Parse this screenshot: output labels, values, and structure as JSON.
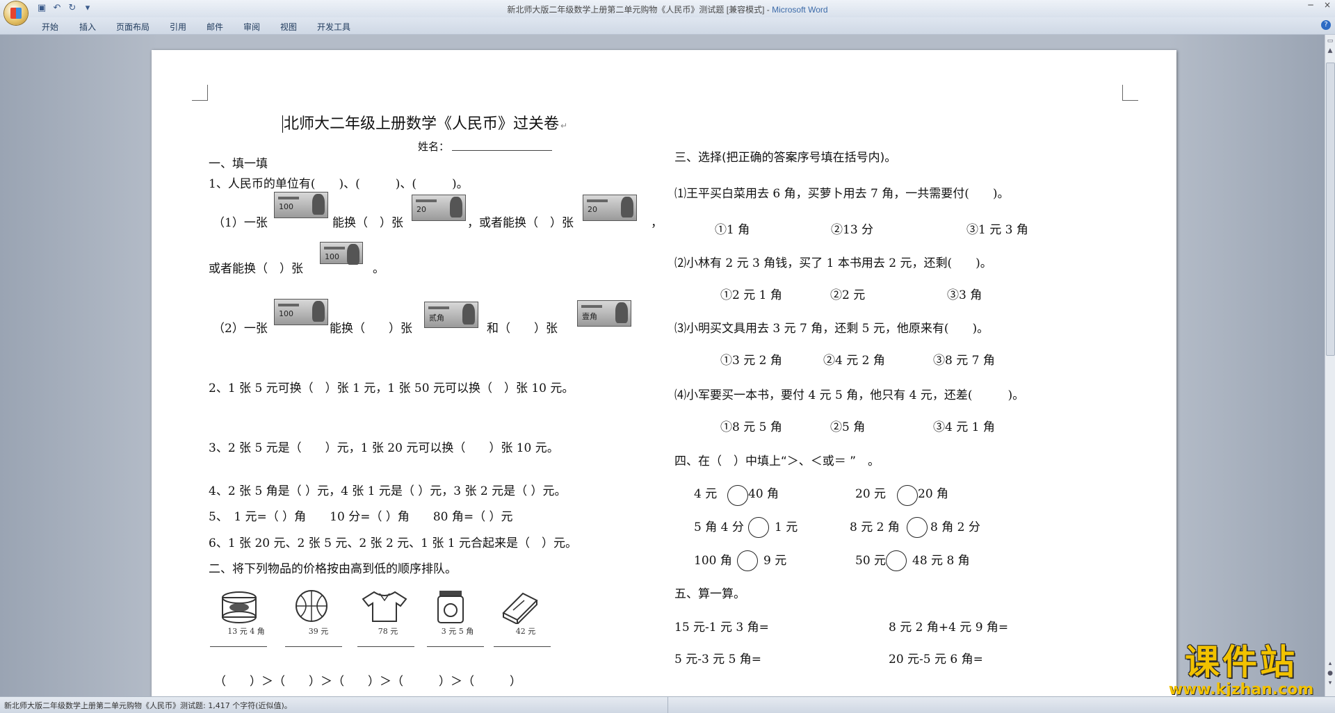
{
  "window": {
    "title": "新北师大版二年级数学上册第二单元购物《人民币》测试题 [兼容模式] - ",
    "app_name": "Microsoft Word",
    "minimize": "−",
    "close": "×"
  },
  "ribbon": {
    "tabs": [
      "开始",
      "插入",
      "页面布局",
      "引用",
      "邮件",
      "审阅",
      "视图",
      "开发工具"
    ],
    "help": "?"
  },
  "quick_access": {
    "save_icon": "save-icon",
    "undo_icon": "undo-icon",
    "redo_icon": "redo-icon",
    "customize_icon": "dropdown-icon"
  },
  "document": {
    "title": "北师大二年级上册数学《人民币》过关卷",
    "name_label": "姓名：",
    "s1_heading": "一、填一填",
    "q1": "1、人民币的单位有(　　)、(　　　)、(　　　)。",
    "q1_1a": "（1）一张",
    "q1_1b": "能换（　）张",
    "q1_1c": "，或者能换（　）张",
    "q1_1d": "，",
    "q1_1e": "或者能换（　）张",
    "q1_1f": "。",
    "q1_2a": "（2）一张",
    "q1_2b": "能换（　　）张",
    "q1_2c": "和（　　）张",
    "q2": "2、1 张 5 元可换（　）张 1 元，1 张 50 元可以换（　）张 10 元。",
    "q3": "3、2 张 5 元是（　　）元，1 张 20 元可以换（　　）张 10 元。",
    "q4": "4、2 张 5 角是（ ）元，4 张 1 元是（ ）元，3 张 2 元是（ ）元。",
    "q5": "5、　1 元=（ ）角　　10 分=（ ）角　　80 角=（ ）元",
    "q6": "6、1 张 20 元、2 张 5 元、2 张 2 元、1 张 1 元合起来是（　）元。",
    "s2_heading": "二、将下列物品的价格按由高到低的顺序排队。",
    "items": [
      {
        "icon": "can-icon",
        "price": "13 元 4 角"
      },
      {
        "icon": "basketball-icon",
        "price": "39 元"
      },
      {
        "icon": "shirt-icon",
        "price": "78 元"
      },
      {
        "icon": "jar-icon",
        "price": "3 元 5 角"
      },
      {
        "icon": "book-icon",
        "price": "42 元"
      }
    ],
    "order_row": "（　　）＞（　　）＞（　　）＞（　　　）＞（　　　）",
    "s3_heading": "三、选择(把正确的答案序号填在括号内)。",
    "c1": "⑴王平买白菜用去 6 角，买萝卜用去 7 角，一共需要付(　　)。",
    "c1_opts": [
      "①1 角",
      "②13 分",
      "③1 元 3 角"
    ],
    "c2": "⑵小林有 2 元 3 角钱，买了 1 本书用去 2 元，还剩(　　)。",
    "c2_opts": [
      "①2 元 1 角",
      "②2 元",
      "③3 角"
    ],
    "c3": "⑶小明买文具用去 3 元 7 角，还剩 5 元，他原来有(　　)。",
    "c3_opts": [
      "①3 元 2 角",
      "②4 元 2 角",
      "③8 元 7 角"
    ],
    "c4": "⑷小军要买一本书，要付 4 元 5 角，他只有 4 元，还差(　　　)。",
    "c4_opts": [
      "①8 元 5 角",
      "②5 角",
      "③4 元 1 角"
    ],
    "s4_heading": "四、在（　）中填上“＞、＜或＝ ”　。",
    "cmp": [
      {
        "l": "4 元",
        "r": "40 角"
      },
      {
        "l": "20 元",
        "r": "20 角"
      },
      {
        "l": "5 角 4 分",
        "r": "1 元"
      },
      {
        "l": "8 元 2 角",
        "r": "8 角 2 分"
      },
      {
        "l": "100 角",
        "r": "9 元"
      },
      {
        "l": "50 元",
        "r": "48 元 8 角"
      }
    ],
    "s5_heading": "五、算一算。",
    "calc": [
      "15 元-1 元 3 角=",
      "8 元 2 角+4 元 9 角=",
      "5 元-3 元 5 角=",
      "20 元-5 元 6 角="
    ],
    "banknotes": [
      "100",
      "20",
      "20",
      "100",
      "100",
      "贰角",
      "壹角"
    ]
  },
  "status": {
    "text": "新北师大版二年级数学上册第二单元购物《人民币》测试题: 1,417 个字符(近似值)。"
  },
  "watermark": {
    "title": "课件站",
    "url": "www.kjzhan.com"
  }
}
